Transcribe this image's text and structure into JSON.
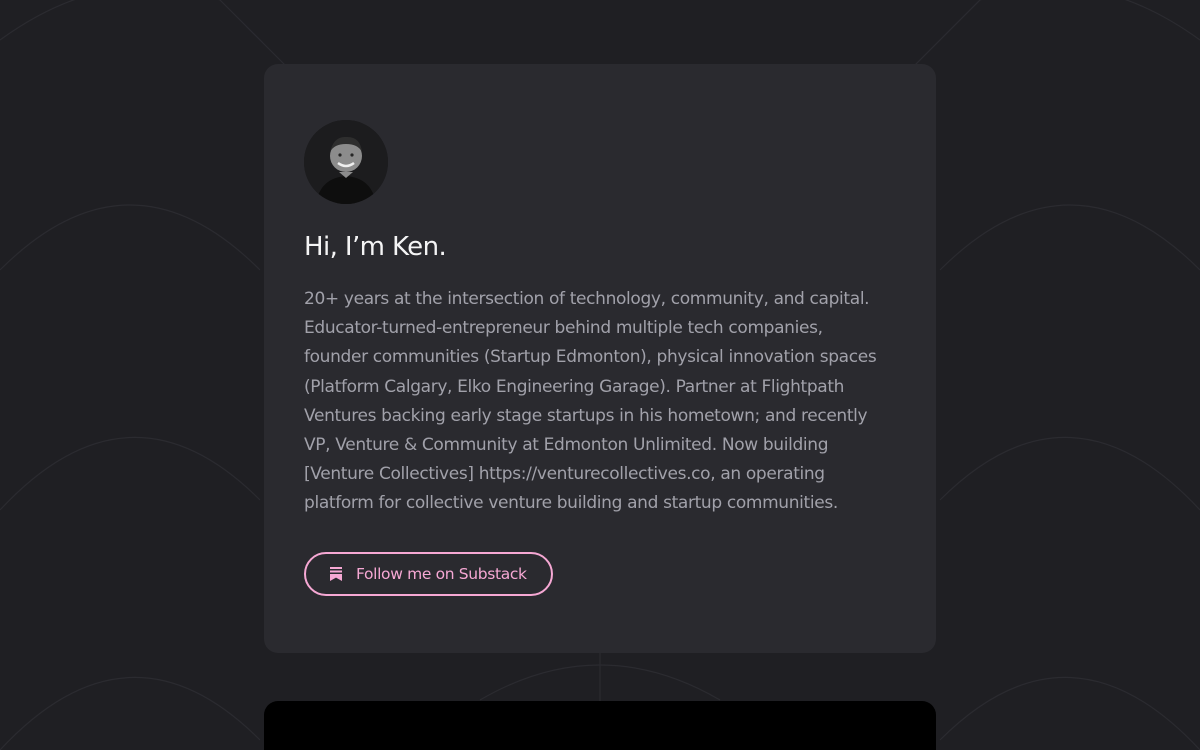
{
  "profile": {
    "avatar_alt": "Ken avatar",
    "heading": "Hi, I’m Ken.",
    "bio_lines": [
      "20+ years at the intersection of technology, community, and capital.",
      "Educator-turned-entrepreneur behind multiple tech companies,",
      "founder communities (Startup Edmonton), physical innovation spaces",
      "(Platform Calgary, Elko Engineering Garage). Partner at Flightpath",
      "Ventures backing early stage startups in his hometown; and recently",
      "VP, Venture & Community at Edmonton Unlimited. Now building",
      "[Venture Collectives] https://venturecollectives.co, an operating",
      "platform for collective venture building and startup communities."
    ]
  },
  "cta": {
    "label": "Follow me on Substack",
    "icon": "substack-icon"
  },
  "colors": {
    "background": "#1f1f23",
    "card": "#2a2a2f",
    "accent": "#f6a8d4",
    "heading": "#f4f4f5",
    "body_text": "#a1a1aa"
  }
}
